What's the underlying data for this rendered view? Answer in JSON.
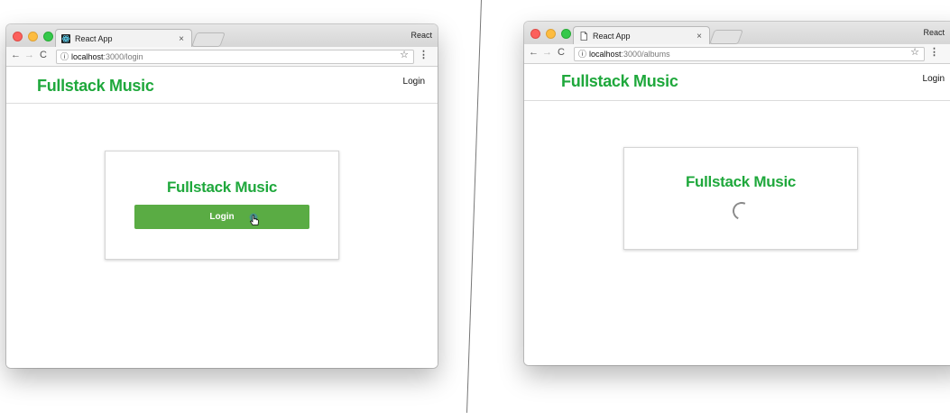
{
  "left_window": {
    "profile_label": "React",
    "tab": {
      "title": "React App",
      "close": "×"
    },
    "address": {
      "info": "ⓘ",
      "host": "localhost",
      "path": ":3000/login"
    },
    "nav": {
      "back": "←",
      "forward": "→",
      "reload": "C"
    },
    "star": "☆",
    "menu": "⋮",
    "app": {
      "brand": "Fullstack Music",
      "nav_login": "Login",
      "card_title": "Fullstack Music",
      "login_button": "Login"
    }
  },
  "right_window": {
    "profile_label": "React",
    "tab": {
      "title": "React App",
      "close": "×"
    },
    "address": {
      "info": "ⓘ",
      "host": "localhost",
      "path": ":3000/albums"
    },
    "nav": {
      "back": "←",
      "forward": "→",
      "reload": "C"
    },
    "star": "☆",
    "menu": "⋮",
    "app": {
      "brand": "Fullstack Music",
      "nav_login": "Login",
      "card_title": "Fullstack Music"
    }
  },
  "colors": {
    "brand_green": "#1fa83c",
    "button_green": "#5aac44"
  }
}
